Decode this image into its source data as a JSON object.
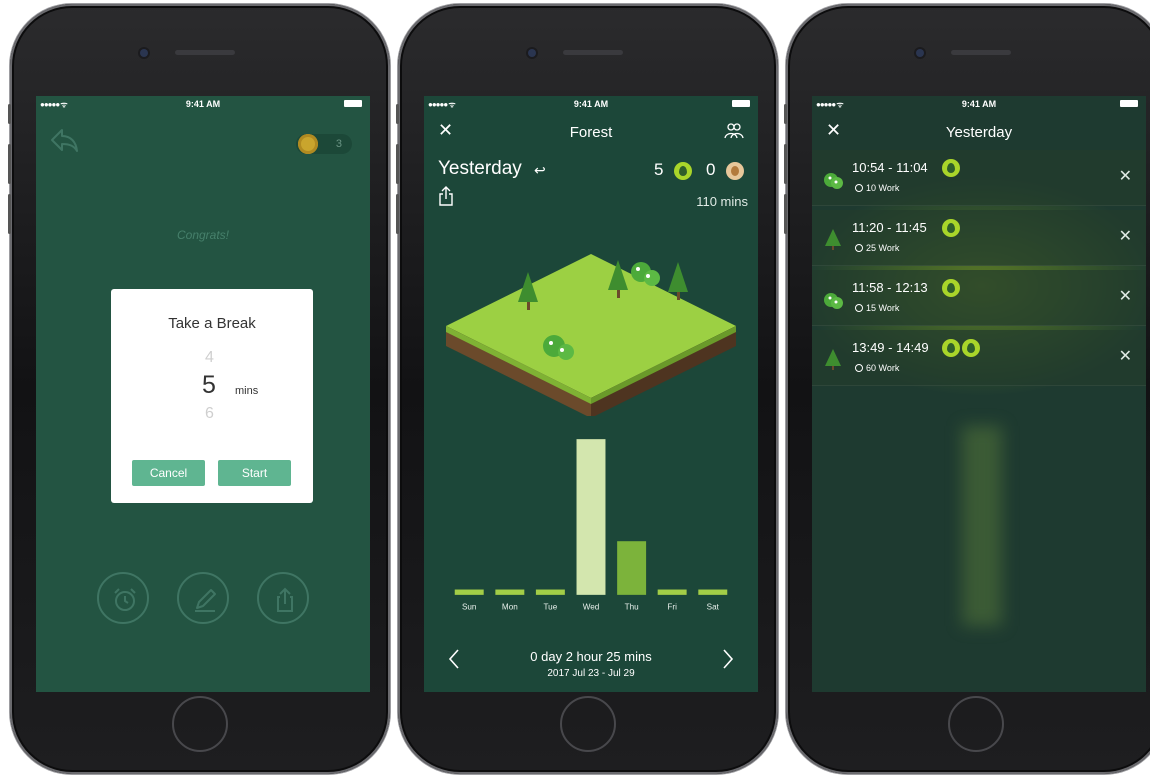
{
  "status_bar": {
    "signal": "●●●●● ᯤ",
    "time": "9:41 AM"
  },
  "screen1": {
    "coin_count": "3",
    "congrats": "Congrats!",
    "dialog": {
      "title": "Take a Break",
      "prev_value": "4",
      "current_value": "5",
      "unit": "mins",
      "next_value": "6",
      "cancel_label": "Cancel",
      "start_label": "Start"
    },
    "bottom_icons": [
      "alarm-clock-icon",
      "pencil-icon",
      "share-icon"
    ]
  },
  "screen2": {
    "nav_title": "Forest",
    "close_glyph": "✕",
    "day_label": "Yesterday",
    "undo_glyph": "↩",
    "trees_alive": "5",
    "trees_dead": "0",
    "total_mins": "110 mins",
    "total_focus": "0 day 2 hour 25 mins",
    "date_range": "2017 Jul 23 - Jul 29",
    "colors": {
      "bar": "#a3cd47",
      "bar_highlight": "#d3e6ae",
      "bar_thu": "#7cb33b",
      "background": "#1c4739"
    }
  },
  "chart_data": {
    "type": "bar",
    "categories": [
      "Sun",
      "Mon",
      "Tue",
      "Wed",
      "Thu",
      "Fri",
      "Sat"
    ],
    "values": [
      5,
      5,
      5,
      145,
      50,
      5,
      5
    ],
    "title": "",
    "xlabel": "",
    "ylabel": "",
    "ylim": [
      0,
      150
    ],
    "grid": false
  },
  "screen3": {
    "nav_title": "Yesterday",
    "close_glyph": "✕",
    "sessions": [
      {
        "time": "10:54 - 11:04",
        "duration": "10",
        "tag": "Work",
        "tree": "bush",
        "leaves": 1
      },
      {
        "time": "11:20 - 11:45",
        "duration": "25",
        "tag": "Work",
        "tree": "pine",
        "leaves": 1
      },
      {
        "time": "11:58 - 12:13",
        "duration": "15",
        "tag": "Work",
        "tree": "bush",
        "leaves": 1
      },
      {
        "time": "13:49 - 14:49",
        "duration": "60",
        "tag": "Work",
        "tree": "pine",
        "leaves": 2
      }
    ]
  }
}
